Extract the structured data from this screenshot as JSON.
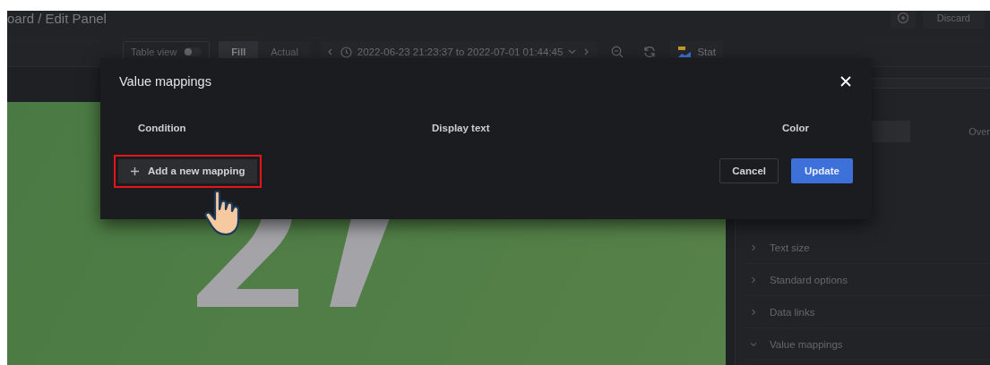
{
  "header": {
    "breadcrumb": "oard / Edit Panel",
    "discard_button": "Discard"
  },
  "toolbar": {
    "table_view": {
      "label": "Table view",
      "on": false
    },
    "size_modes": [
      {
        "label": "Fill",
        "selected": true
      },
      {
        "label": "Actual",
        "selected": false
      }
    ],
    "time_range": "2022-06-23 21:23:37 to 2022-07-01 01:44:45",
    "visualization": "Stat"
  },
  "options": {
    "tabs": [
      {
        "label": "Over",
        "selected": false
      }
    ],
    "sections": [
      {
        "label": "Text size",
        "expanded": false
      },
      {
        "label": "Standard options",
        "expanded": false
      },
      {
        "label": "Data links",
        "expanded": false
      },
      {
        "label": "Value mappings",
        "expanded": true
      }
    ]
  },
  "modal": {
    "title": "Value mappings",
    "columns": [
      "Condition",
      "Display text",
      "Color"
    ],
    "add_button": {
      "label": "Add a new mapping",
      "highlighted": true
    },
    "buttons": [
      {
        "label": "Cancel",
        "kind": "secondary"
      },
      {
        "label": "Update",
        "kind": "primary"
      }
    ]
  }
}
